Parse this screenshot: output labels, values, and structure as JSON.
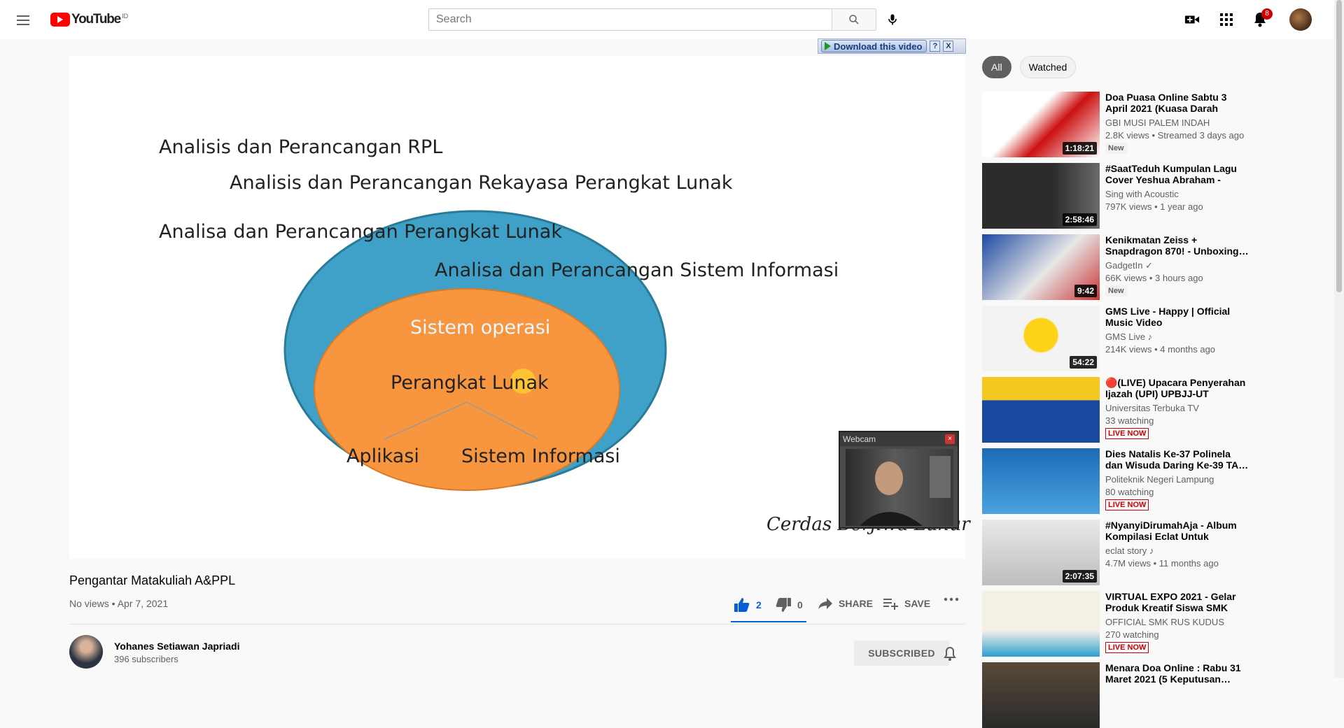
{
  "masthead": {
    "logo_text": "YouTube",
    "country_code": "ID",
    "search_placeholder": "Search",
    "notifications_count": "8"
  },
  "player": {
    "download_label": "Download this video",
    "download_help": "?",
    "download_close": "X",
    "slide": {
      "line1": "Analisis dan Perancangan RPL",
      "line2": "Analisis dan Perancangan Rekayasa  Perangkat Lunak",
      "line3": "Analisa dan Perancangan Perangkat Lunak",
      "line4": "Analisa dan Perancangan Sistem Informasi",
      "outer_label": "Sistem operasi",
      "inner_label": "Perangkat Lunak",
      "left_label": "Aplikasi",
      "right_label": "Sistem Informasi",
      "signature": "Cerdas Berjiwa Luhur"
    },
    "webcam_title": "Webcam"
  },
  "video": {
    "title": "Pengantar Matakuliah A&PPL",
    "views": "No views",
    "date": "Apr 7, 2021",
    "likes": "2",
    "dislikes": "0",
    "share_label": "SHARE",
    "save_label": "SAVE"
  },
  "channel": {
    "name": "Yohanes Setiawan Japriadi",
    "subscribers": "396 subscribers",
    "subscribe_label": "SUBSCRIBED"
  },
  "sidebar": {
    "chips": [
      "All",
      "Watched"
    ],
    "recommendations": [
      {
        "title": "Doa Puasa Online Sabtu 3 April 2021 (Kuasa Darah Yesus)",
        "channel": "GBI MUSI PALEM INDAH",
        "stats": "2.8K views • Streamed 3 days ago",
        "badge": "New",
        "duration": "1:18:21"
      },
      {
        "title": "#SaatTeduh Kumpulan Lagu Cover Yeshua Abraham - Lagu…",
        "channel": "Sing with Acoustic",
        "stats": "797K views • 1 year ago",
        "badge": "",
        "duration": "2:58:46"
      },
      {
        "title": "Kenikmatan Zeiss + Snapdragon 870! - Unboxing…",
        "channel": "GadgetIn ✓",
        "stats": "66K views • 3 hours ago",
        "badge": "New",
        "duration": "9:42"
      },
      {
        "title": "GMS Live - Happy | Official Music Video",
        "channel": "GMS Live ♪",
        "stats": "214K views • 4 months ago",
        "badge": "",
        "duration": "54:22"
      },
      {
        "title": "🔴(LIVE) Upacara Penyerahan Ijazah (UPI) UPBJJ-UT Medan…",
        "channel": "Universitas Terbuka TV",
        "stats": "33 watching",
        "badge": "LIVE NOW",
        "duration": ""
      },
      {
        "title": "Dies Natalis Ke-37 Polinela dan Wisuda Daring Ke-39 TA…",
        "channel": "Politeknik Negeri Lampung",
        "stats": "80 watching",
        "badge": "LIVE NOW",
        "duration": ""
      },
      {
        "title": "#NyanyiDirumahAja - Album Kompilasi Eclat Untuk Nemeni…",
        "channel": "eclat story ♪",
        "stats": "4.7M views • 11 months ago",
        "badge": "",
        "duration": "2:07:35"
      },
      {
        "title": "VIRTUAL EXPO 2021 - Gelar Produk Kreatif Siswa SMK RU…",
        "channel": "OFFICIAL SMK RUS KUDUS",
        "stats": "270 watching",
        "badge": "LIVE NOW",
        "duration": ""
      },
      {
        "title": "Menara Doa Online : Rabu 31 Maret 2021 (5 Keputusan…",
        "channel": "",
        "stats": "",
        "badge": "",
        "duration": ""
      }
    ]
  },
  "colors": {
    "brand_red": "#ff0000",
    "like_blue": "#065fd4",
    "live_red": "#cc0000"
  }
}
